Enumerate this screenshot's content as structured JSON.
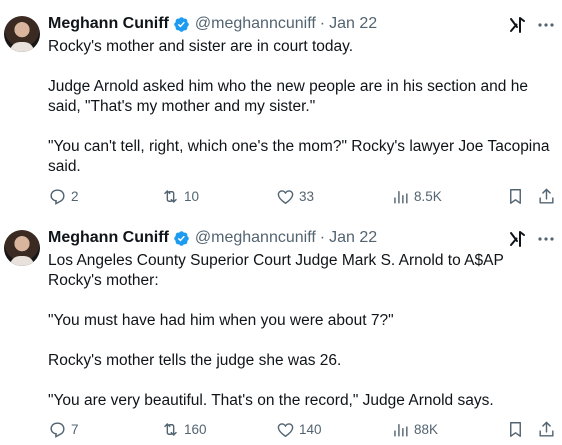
{
  "tweets": [
    {
      "author": "Meghann Cuniff",
      "handle": "@meghanncuniff",
      "separator": "·",
      "date": "Jan 22",
      "lines": [
        "Rocky's mother and sister are in court today.",
        "",
        "Judge Arnold asked him who the new people are in his section and he said, \"That's my mother and my sister.\"",
        "",
        "\"You can't tell, right, which one's the mom?\" Rocky's lawyer Joe Tacopina said."
      ],
      "replies": "2",
      "reposts": "10",
      "likes": "33",
      "views": "8.5K"
    },
    {
      "author": "Meghann Cuniff",
      "handle": "@meghanncuniff",
      "separator": "·",
      "date": "Jan 22",
      "lines": [
        "Los Angeles County Superior Court Judge Mark S. Arnold to A$AP Rocky's mother:",
        "",
        "\"You must have had him when you were about 7?\"",
        "",
        "Rocky's mother tells the judge she was 26.",
        "",
        "\"You are very beautiful. That's on the record,\" Judge Arnold says."
      ],
      "replies": "7",
      "reposts": "160",
      "likes": "140",
      "views": "88K"
    }
  ],
  "colors": {
    "verified": "#1d9bf0",
    "muted": "#536471",
    "text": "#0f1419"
  }
}
